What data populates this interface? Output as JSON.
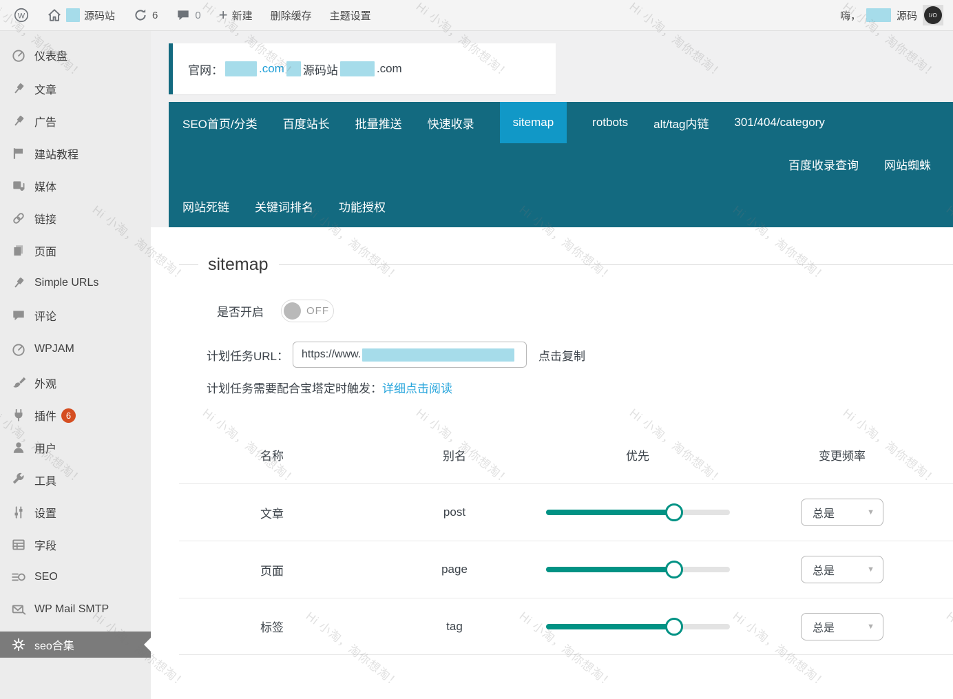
{
  "admin_bar": {
    "site_name": "源码站",
    "updates_count": "6",
    "comments_count": "0",
    "new_label": "新建",
    "clear_cache_label": "删除缓存",
    "theme_settings_label": "主题设置",
    "greeting": "嗨，",
    "user_name": "源码",
    "avatar_text": "I/O"
  },
  "sidebar": {
    "items": [
      {
        "id": "dashboard",
        "label": "仪表盘",
        "icon": "gauge-icon",
        "gap": false
      },
      {
        "id": "posts",
        "label": "文章",
        "icon": "pin-icon",
        "gap": true
      },
      {
        "id": "ads",
        "label": "广告",
        "icon": "pin-icon",
        "gap": false
      },
      {
        "id": "tutorials",
        "label": "建站教程",
        "icon": "flag-icon",
        "gap": false
      },
      {
        "id": "media",
        "label": "媒体",
        "icon": "media-icon",
        "gap": false
      },
      {
        "id": "links",
        "label": "链接",
        "icon": "link-icon",
        "gap": false
      },
      {
        "id": "pages",
        "label": "页面",
        "icon": "pages-icon",
        "gap": false
      },
      {
        "id": "simple-urls",
        "label": "Simple URLs",
        "icon": "pin-icon",
        "gap": false
      },
      {
        "id": "comments",
        "label": "评论",
        "icon": "comment-icon",
        "gap": false
      },
      {
        "id": "wpjam",
        "label": "WPJAM",
        "icon": "gauge-icon",
        "gap": true
      },
      {
        "id": "appearance",
        "label": "外观",
        "icon": "brush-icon",
        "gap": true
      },
      {
        "id": "plugins",
        "label": "插件",
        "icon": "plug-icon",
        "badge": "6",
        "gap": false
      },
      {
        "id": "users",
        "label": "用户",
        "icon": "user-icon",
        "gap": false
      },
      {
        "id": "tools",
        "label": "工具",
        "icon": "wrench-icon",
        "gap": false
      },
      {
        "id": "settings",
        "label": "设置",
        "icon": "sliders-icon",
        "gap": false
      },
      {
        "id": "fields",
        "label": "字段",
        "icon": "fields-icon",
        "gap": false
      },
      {
        "id": "seo",
        "label": "SEO",
        "icon": "seo-icon",
        "gap": false
      },
      {
        "id": "wp-mail-smtp",
        "label": "WP Mail SMTP",
        "icon": "mail-icon",
        "gap": false
      },
      {
        "id": "seo-collection",
        "label": "seo合集",
        "icon": "gear-icon",
        "active": true,
        "gap": true
      }
    ]
  },
  "notice": {
    "prefix": "官网：",
    "domain_suffix_link": ".com",
    "middle_text": "源码站",
    "domain_suffix_plain": ".com"
  },
  "nav": {
    "active_tab": "sitemap",
    "rows": [
      [
        "SEO首页/分类",
        "百度站长",
        "批量推送",
        "快速收录",
        "sitemap",
        "rotbots",
        "alt/tag内链",
        "301/404/category"
      ],
      [
        "百度收录查询",
        "网站蜘蛛"
      ],
      [
        "网站死链",
        "关键词排名",
        "功能授权"
      ]
    ]
  },
  "main": {
    "section_title": "sitemap",
    "enable_label": "是否开启",
    "toggle_state": "OFF",
    "cron_label": "计划任务URL：",
    "cron_value": "https://www.",
    "copy_label": "点击复制",
    "cron_note": "计划任务需要配合宝塔定时触发：",
    "cron_link": "详细点击阅读",
    "table": {
      "headers": [
        "名称",
        "别名",
        "优先",
        "变更频率"
      ],
      "rows": [
        {
          "name": "文章",
          "alias": "post",
          "priority_percent": 70,
          "frequency": "总是"
        },
        {
          "name": "页面",
          "alias": "page",
          "priority_percent": 70,
          "frequency": "总是"
        },
        {
          "name": "标签",
          "alias": "tag",
          "priority_percent": 70,
          "frequency": "总是"
        }
      ]
    }
  },
  "watermark": {
    "text": "Hi 小淘，淘你想淘！"
  },
  "colors": {
    "nav_bg": "#136a80",
    "nav_active": "#1198c7",
    "slider": "#019284",
    "link": "#27a5dc",
    "redact": "#a6dcea",
    "badge": "#d54e21",
    "active_menu_bg": "#7b7b7b"
  }
}
